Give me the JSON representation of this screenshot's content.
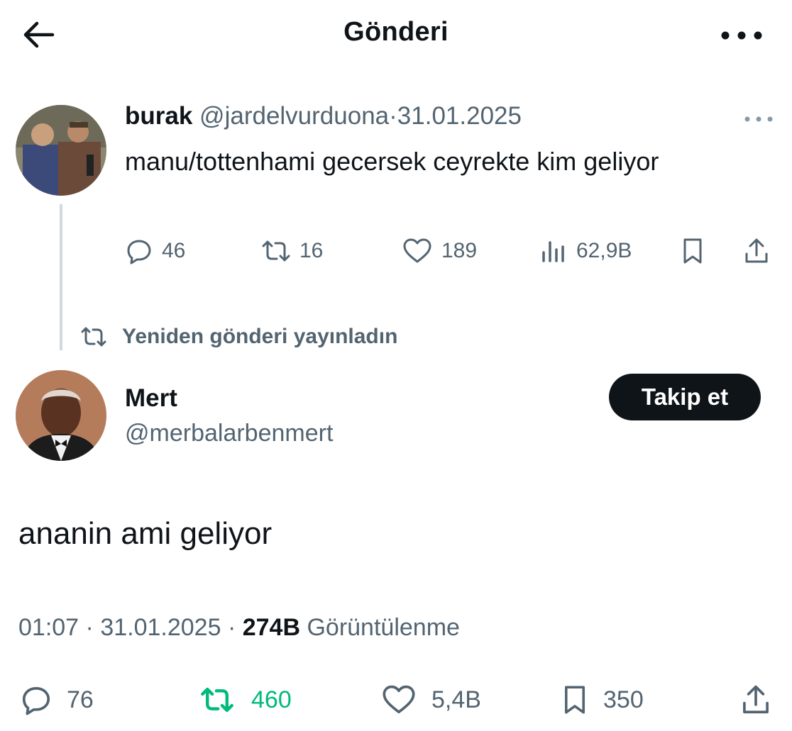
{
  "header": {
    "title": "Gönderi",
    "back_icon": "arrow-left-icon",
    "more_icon": "more-horizontal-icon"
  },
  "quoted_post": {
    "display_name": "burak",
    "handle": "@jardelvurduona",
    "separator": "·",
    "date": "31.01.2025",
    "text": "manu/tottenhami gecersek ceyrekte kim geliyor",
    "actions": {
      "replies": "46",
      "reposts": "16",
      "likes": "189",
      "views": "62,9B"
    }
  },
  "repost_notice": "Yeniden gönderi yayınladın",
  "main_post": {
    "display_name": "Mert",
    "handle": "@merbalarbenmert",
    "follow_label": "Takip et",
    "text": "ananin ami geliyor",
    "time": "01:07",
    "separator": "·",
    "date": "31.01.2025",
    "views_count": "274B",
    "views_label": "Görüntülenme",
    "actions": {
      "replies": "76",
      "reposts": "460",
      "likes": "5,4B",
      "bookmarks": "350"
    }
  },
  "colors": {
    "text": "#0f1419",
    "muted": "#536471",
    "repost_green": "#00ba7c",
    "follow_bg": "#0f1419"
  }
}
